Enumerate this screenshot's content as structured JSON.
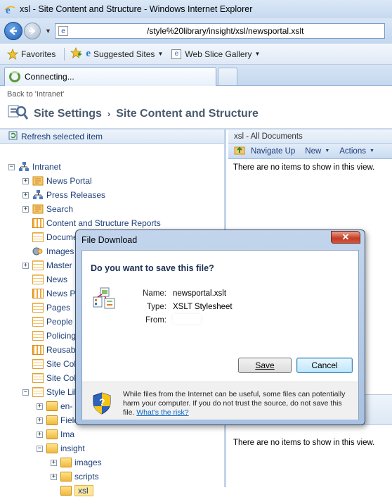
{
  "browser": {
    "window_title": "xsl - Site Content and Structure - Windows Internet Explorer",
    "address": "/style%20library/insight/xsl/newsportal.xslt",
    "favorites_label": "Favorites",
    "suggested_sites_label": "Suggested Sites",
    "web_slice_gallery_label": "Web Slice Gallery",
    "tab_label": "Connecting..."
  },
  "page": {
    "back_link": "Back to 'Intranet'",
    "breadcrumb_root": "Site Settings",
    "breadcrumb_separator": "›",
    "breadcrumb_current": "Site Content and Structure",
    "refresh_label": "Refresh selected item"
  },
  "tree": {
    "root": "Intranet",
    "items": [
      "News Portal",
      "Press Releases",
      "Search",
      "Content and Structure Reports",
      "Documents",
      "Images",
      "Master",
      "News",
      "News P",
      "Pages",
      "People",
      "Policing",
      "Reusab",
      "Site Coll",
      "Site Coll",
      "Style Lib",
      "en-",
      "Field",
      "Ima",
      "insight",
      "images",
      "scripts",
      "xsl"
    ]
  },
  "right": {
    "header": "xsl - All Documents",
    "navigate_up": "Navigate Up",
    "new_label": "New",
    "actions_label": "Actions",
    "no_items": "There are no items to show in this view.",
    "no_items_2": "There are no items to show in this view."
  },
  "dialog": {
    "title": "File Download",
    "question": "Do you want to save this file?",
    "name_key": "Name:",
    "name_val": "newsportal.xslt",
    "type_key": "Type:",
    "type_val": "XSLT Stylesheet",
    "from_key": "From:",
    "save_label": "Save",
    "cancel_label": "Cancel",
    "warning": "While files from the Internet can be useful, some files can potentially harm your computer. If you do not trust the source, do not save this file.",
    "risk_link": "What's the risk?"
  }
}
